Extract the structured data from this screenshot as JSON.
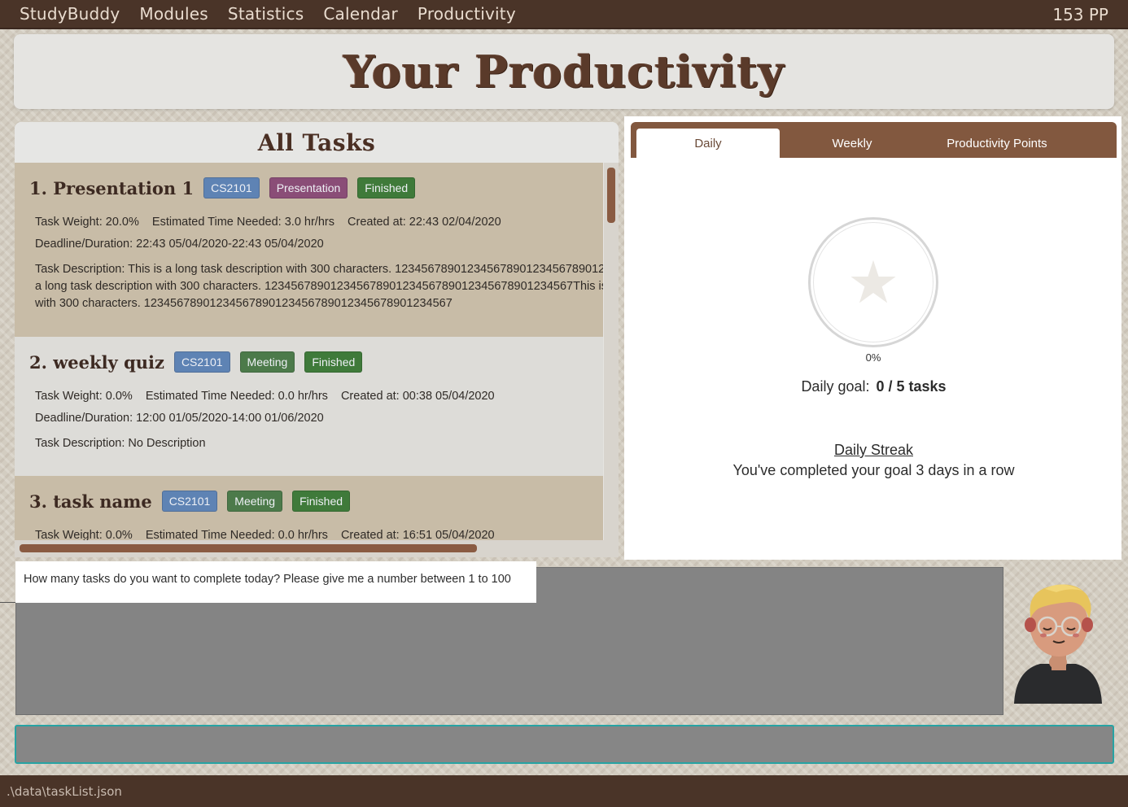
{
  "menu": {
    "app_name": "StudyBuddy",
    "items": [
      "Modules",
      "Statistics",
      "Calendar",
      "Productivity"
    ],
    "points": "153 PP"
  },
  "title": "Your Productivity",
  "tasks_panel": {
    "header": "All Tasks",
    "tasks": [
      {
        "title": "1.  Presentation 1",
        "module": "CS2101",
        "type": "Presentation",
        "status": "Finished",
        "weight": "Task Weight: 20.0%",
        "time": "Estimated Time Needed: 3.0 hr/hrs",
        "created": "Created at: 22:43 02/04/2020",
        "deadline": "Deadline/Duration: 22:43 05/04/2020-22:43 05/04/2020",
        "desc_lines": [
          "Task Description: This is a long task description with 300 characters. 12345678901234567890123456789012",
          "a long task description with 300 characters. 12345678901234567890123456789012345678901234567This is",
          "with 300 characters. 12345678901234567890123456789012345678901234567"
        ]
      },
      {
        "title": "2.  weekly quiz",
        "module": "CS2101",
        "type": "Meeting",
        "status": "Finished",
        "weight": "Task Weight: 0.0%",
        "time": "Estimated Time Needed: 0.0 hr/hrs",
        "created": "Created at: 00:38 05/04/2020",
        "deadline": "Deadline/Duration: 12:00 01/05/2020-14:00 01/06/2020",
        "desc_lines": [
          "Task Description: No Description"
        ]
      },
      {
        "title": "3.  task name",
        "module": "CS2101",
        "type": "Meeting",
        "status": "Finished",
        "weight": "Task Weight: 0.0%",
        "time": "Estimated Time Needed: 0.0 hr/hrs",
        "created": "Created at: 16:51 05/04/2020"
      }
    ]
  },
  "stats": {
    "tabs": [
      "Daily",
      "Weekly",
      "Productivity Points"
    ],
    "active_tab": "Daily",
    "progress_percent": "0%",
    "goal_label": "Daily goal:",
    "goal_value": "0 / 5 tasks",
    "streak_title": "Daily Streak",
    "streak_text": "You've completed your goal 3 days in a row"
  },
  "result_display": "How many tasks do you want to complete today? Please give me a number between 1 to 100",
  "command_box": {
    "value": ""
  },
  "status_bar": ".\\data\\taskList.json",
  "colors": {
    "menubar": "#4a3428",
    "tab_bar": "#82583f",
    "module_tag": "#5e83b4",
    "presentation_tag": "#8a4d77",
    "meeting_tag": "#4c7a4a",
    "finished_tag": "#3f7a3a",
    "command_border": "#27a3a3"
  },
  "icons": {
    "progress": "star-icon",
    "avatar": "avatar-icon"
  }
}
